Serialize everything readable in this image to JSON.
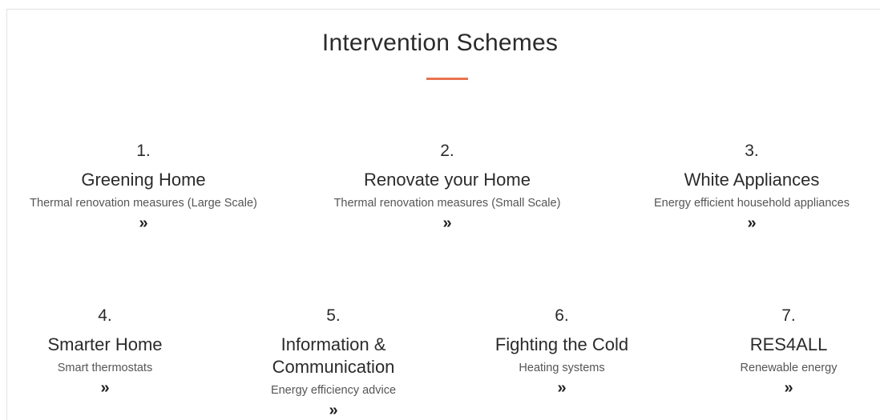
{
  "section": {
    "title": "Intervention Schemes"
  },
  "schemes": [
    {
      "number": "1.",
      "name": "Greening Home",
      "description": "Thermal renovation measures (Large Scale)",
      "link": "»"
    },
    {
      "number": "2.",
      "name": "Renovate your Home",
      "description": "Thermal renovation measures (Small Scale)",
      "link": "»"
    },
    {
      "number": "3.",
      "name": "White Appliances",
      "description": "Energy efficient household appliances",
      "link": "»"
    },
    {
      "number": "4.",
      "name": "Smarter Home",
      "description": "Smart thermostats",
      "link": "»"
    },
    {
      "number": "5.",
      "name": "Information & Communication",
      "description": "Energy efficiency advice",
      "link": "»"
    },
    {
      "number": "6.",
      "name": "Fighting the Cold",
      "description": "Heating systems",
      "link": "»"
    },
    {
      "number": "7.",
      "name": "RES4ALL",
      "description": "Renewable energy",
      "link": "»"
    }
  ],
  "colors": {
    "accent": "#e8734f",
    "text": "#2b2b2b",
    "muted": "#555555"
  }
}
